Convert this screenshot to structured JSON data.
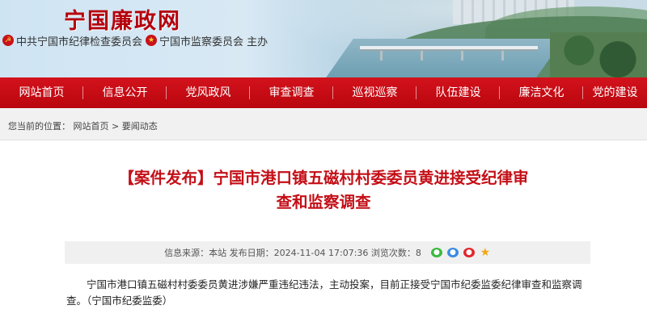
{
  "header": {
    "site_title": "宁国廉政网",
    "host_part1": "中共宁国市纪律检查委员会",
    "host_part2": "宁国市监察委员会 主办"
  },
  "nav": {
    "items": [
      "网站首页",
      "信息公开",
      "党风政风",
      "审查调查",
      "巡视巡察",
      "队伍建设",
      "廉洁文化",
      "党的建设"
    ]
  },
  "breadcrumb": {
    "prefix": "您当前的位置：",
    "home": "网站首页",
    "separator": ">",
    "section": "要闻动态"
  },
  "article": {
    "title_line1": "【案件发布】宁国市港口镇五磁村村委委员黄进接受纪律审",
    "title_line2": "查和监察调查",
    "meta": {
      "source_label": "信息来源：",
      "source": "本站",
      "date_label": "发布日期：",
      "date": "2024-11-04 17:07:36",
      "views_label": "浏览次数：",
      "views": "8"
    },
    "body": "宁国市港口镇五磁村村委委员黄进涉嫌严重违纪违法，主动投案，目前正接受宁国市纪委监委纪律审查和监察调查。（宁国市纪委监委）"
  },
  "share_icons": [
    "wechat-icon",
    "qq-icon",
    "weibo-icon",
    "star-icon"
  ],
  "colors": {
    "brand_red": "#c40f17",
    "nav_red": "#c80c15",
    "title_red": "#b4000c"
  }
}
